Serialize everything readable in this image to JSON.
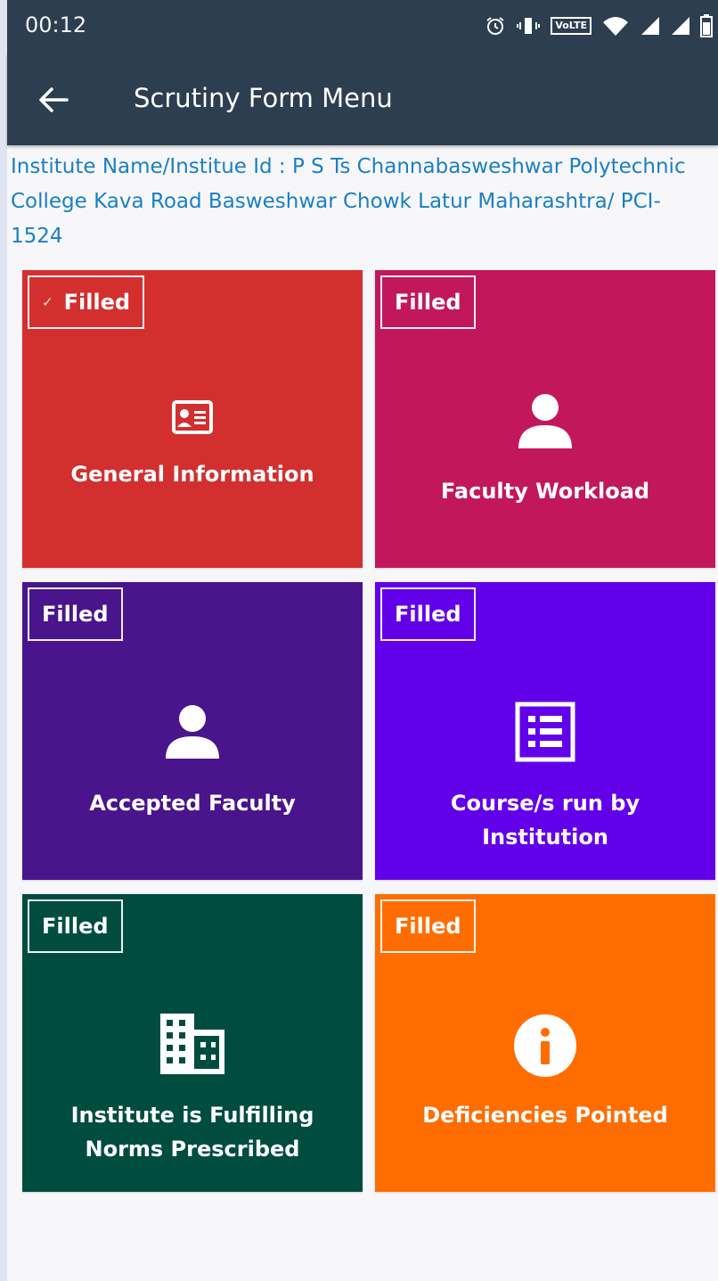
{
  "status_bar": {
    "time": "00:12",
    "network_badge": "VoLTE",
    "icons": [
      "alarm-icon",
      "vibrate-icon",
      "volte-icon",
      "wifi-icon",
      "signal-icon",
      "signal-icon",
      "battery-icon"
    ]
  },
  "app_bar": {
    "title": "Scrutiny Form Menu",
    "back_icon": "arrow-left-icon"
  },
  "institute": {
    "text": "Institute Name/Institue Id : P S Ts Channabasweshwar Polytechnic College Kava Road Basweshwar Chowk Latur Maharashtra/ PCI-1524"
  },
  "tiles": [
    {
      "label": "General Information",
      "status": "Filled",
      "color": "#d32f2f",
      "icon": "id-card-icon"
    },
    {
      "label": "Faculty Workload",
      "status": "Filled",
      "color": "#c2185b",
      "icon": "person-icon"
    },
    {
      "label": "Accepted Faculty",
      "status": "Filled",
      "color": "#4a148c",
      "icon": "person-icon"
    },
    {
      "label": "Course/s run by Institution",
      "status": "Filled",
      "color": "#6200ea",
      "icon": "list-icon"
    },
    {
      "label": "Institute is Fulfilling Norms Prescribed",
      "status": "Filled",
      "color": "#004d40",
      "icon": "building-icon"
    },
    {
      "label": "Deficiencies Pointed",
      "status": "Filled",
      "color": "#ff6d00",
      "icon": "info-icon"
    }
  ]
}
